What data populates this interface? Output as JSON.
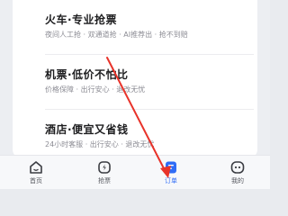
{
  "menu": [
    {
      "title": "火车·专业抢票",
      "subtitle": "夜间人工抢 · 双通道抢 · AI推荐出 · 抢不到赔"
    },
    {
      "title": "机票·低价不怕比",
      "subtitle": "价格保障 · 出行安心 · 退改无忧"
    },
    {
      "title": "酒店·便宜又省钱",
      "subtitle": "24小时客服 · 出行安心 · 退改无忧"
    }
  ],
  "tabbar": [
    {
      "label": "首页",
      "icon": "home-icon"
    },
    {
      "label": "抢票",
      "icon": "lightning-icon"
    },
    {
      "label": "订单",
      "icon": "order-icon",
      "active": true
    },
    {
      "label": "我的",
      "icon": "profile-icon"
    }
  ],
  "colors": {
    "accent": "#2f6cf6",
    "annotation": "#e8332a"
  }
}
